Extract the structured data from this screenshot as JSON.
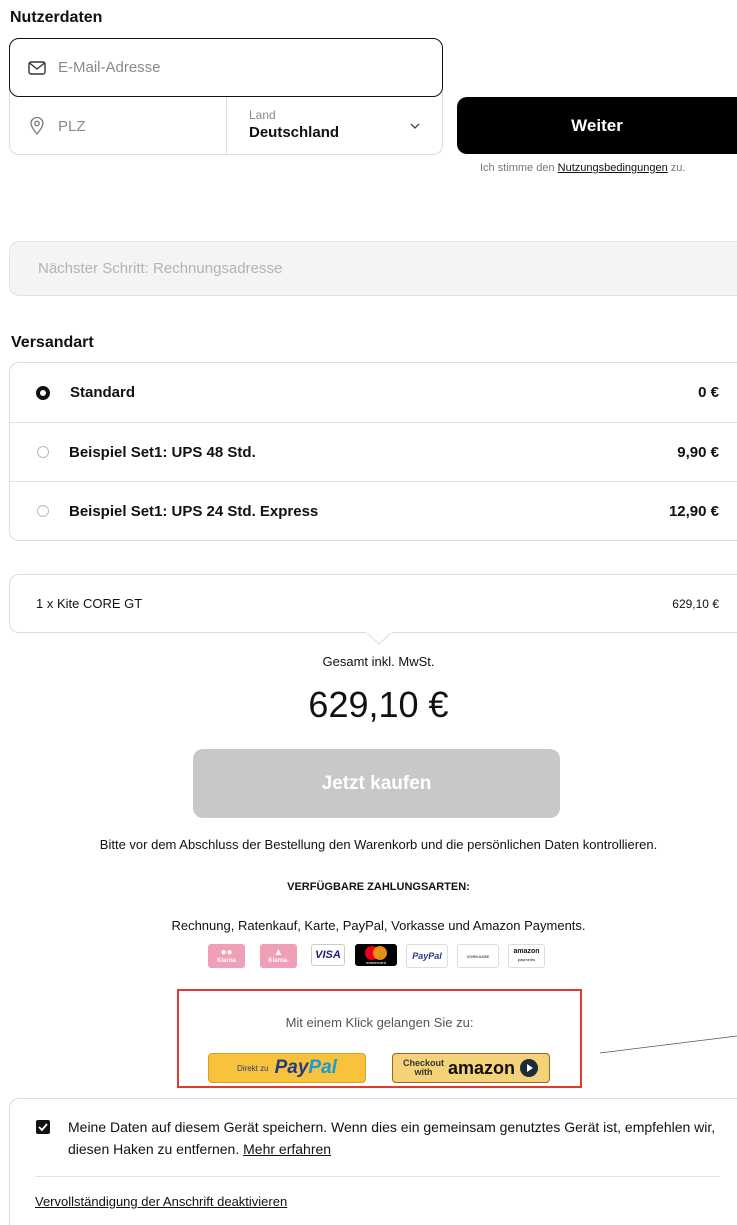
{
  "user_section": {
    "title": "Nutzerdaten",
    "email_placeholder": "E-Mail-Adresse",
    "zip_placeholder": "PLZ",
    "country_label": "Land",
    "country_value": "Deutschland",
    "continue_button": "Weiter",
    "terms_prefix": "Ich stimme den ",
    "terms_link": "Nutzungsbedingungen",
    "terms_suffix": " zu.",
    "next_step": "Nächster Schritt: Rechnungsadresse"
  },
  "shipping": {
    "title": "Versandart",
    "options": [
      {
        "label": "Standard",
        "price": "0 €",
        "selected": true
      },
      {
        "label": "Beispiel Set1: UPS 48 Std.",
        "price": "9,90 €",
        "selected": false
      },
      {
        "label": "Beispiel Set1: UPS 24 Std. Express",
        "price": "12,90 €",
        "selected": false
      }
    ]
  },
  "cart": {
    "item": "1 x Kite CORE GT",
    "item_price": "629,10 €",
    "total_label": "Gesamt inkl. MwSt.",
    "total_value": "629,10 €",
    "buy_button": "Jetzt kaufen",
    "notice": "Bitte vor dem Abschluss der Bestellung den Warenkorb und die persönlichen Daten kontrollieren."
  },
  "payment": {
    "title": "VERFÜGBARE ZAHLUNGSARTEN:",
    "methods_text": "Rechnung, Ratenkauf, Karte, PayPal, Vorkasse und Amazon Payments.",
    "logos": [
      "Klarna",
      "Klarna.",
      "VISA",
      "mastercard",
      "PayPal",
      "VORKASSE",
      "amazon",
      "payments"
    ],
    "express_title": "Mit einem Klick gelangen Sie zu:",
    "paypal_prefix": "Direkt zu",
    "paypal_brand_1": "Pay",
    "paypal_brand_2": "Pal",
    "amazon_checkout_1": "Checkout",
    "amazon_checkout_2": "with",
    "amazon_brand": "amazon"
  },
  "footer": {
    "save_text": "Meine Daten auf diesem Gerät speichern. Wenn dies ein gemeinsam genutztes Gerät ist, empfehlen wir, diesen Haken zu entfernen. ",
    "save_link": "Mehr erfahren",
    "save_checked": true,
    "autocomplete_link": "Vervollständigung der Anschrift deaktivieren"
  },
  "colors": {
    "highlight_border": "#e0392d",
    "buy_disabled": "#c8c8c8",
    "paypal_yellow": "#f9c23c",
    "klarna_pink": "#f0a0b6"
  }
}
